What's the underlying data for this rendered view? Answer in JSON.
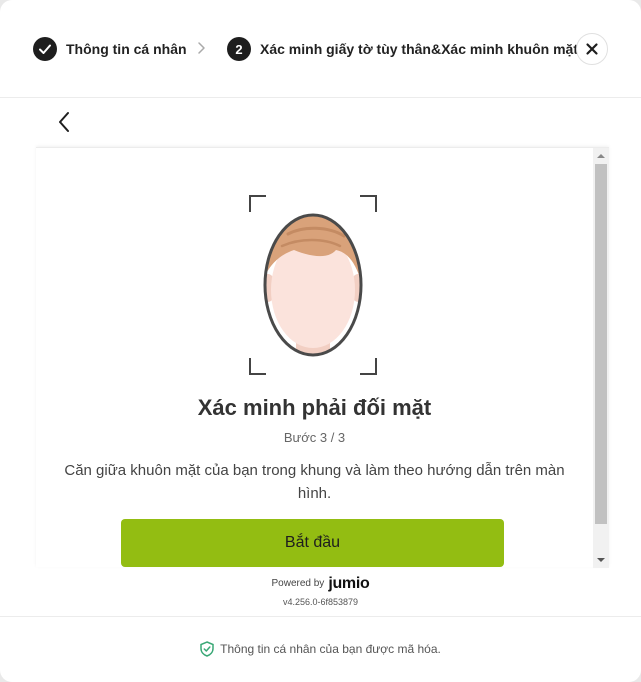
{
  "stepper": {
    "step1": {
      "label": "Thông tin cá nhân",
      "state": "completed"
    },
    "step2": {
      "number": "2",
      "label": "Xác minh giấy tờ tùy thân&Xác minh khuôn mặt",
      "state": "active"
    }
  },
  "main": {
    "title": "Xác minh phải đối mặt",
    "step_count": "Bước 3 / 3",
    "instruction": "Căn giữa khuôn mặt của bạn trong khung và làm theo hướng dẫn trên màn hình.",
    "start_label": "Bắt đầu"
  },
  "branding": {
    "powered_by": "Powered by",
    "logo_text": "jumio",
    "version": "v4.256.0-6f853879"
  },
  "footer": {
    "secure_note": "Thông tin cá nhân của bạn được mã hóa."
  },
  "colors": {
    "accent": "#93bd12",
    "shield": "#3aa876",
    "dark": "#1e1e1e"
  }
}
